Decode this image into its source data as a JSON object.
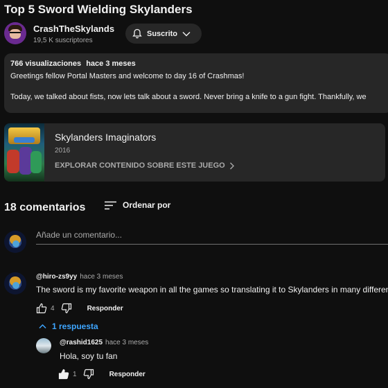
{
  "video": {
    "title": "Top 5 Sword Wielding Skylanders"
  },
  "channel": {
    "name": "CrashTheSkylands",
    "subscribers": "19,5 K suscriptores",
    "subscribe_label": "Suscrito"
  },
  "description": {
    "views": "766 visualizaciones",
    "date": "hace 3 meses",
    "line1": "Greetings fellow Portal Masters and welcome to day 16 of Crashmas!",
    "line2": "Today, we talked about fists, now lets talk about a sword. Never bring a knife to a gun fight. Thankfully, we"
  },
  "game": {
    "title": "Skylanders Imaginators",
    "year": "2016",
    "explore_label": "EXPLORAR CONTENIDO SOBRE ESTE JUEGO"
  },
  "comments": {
    "count_label": "18 comentarios",
    "sort_label": "Ordenar por",
    "add_placeholder": "Añade un comentario...",
    "items": [
      {
        "author": "@hiro-zs9yy",
        "time": "hace 3 meses",
        "text": "The sword is my favorite weapon in all the games so translating it to Skylanders in many different",
        "likes": "4",
        "reply_label": "Responder",
        "replies_label": "1 respuesta",
        "replies": [
          {
            "author": "@rashid1625",
            "time": "hace 3 meses",
            "text": "Hola, soy tu fan",
            "likes": "1",
            "reply_label": "Responder"
          }
        ]
      }
    ]
  },
  "colors": {
    "background": "#0f0f0f",
    "surface": "#272727",
    "link_blue": "#3ea6ff",
    "muted_text": "#aaaaaa"
  },
  "icons": {
    "subscribe": "bell-icon",
    "subscribe_menu": "chevron-down-icon",
    "explore": "chevron-right-icon",
    "sort": "sort-lines-icon",
    "like": "thumbs-up-icon",
    "dislike": "thumbs-down-icon",
    "replies": "chevron-up-icon"
  }
}
